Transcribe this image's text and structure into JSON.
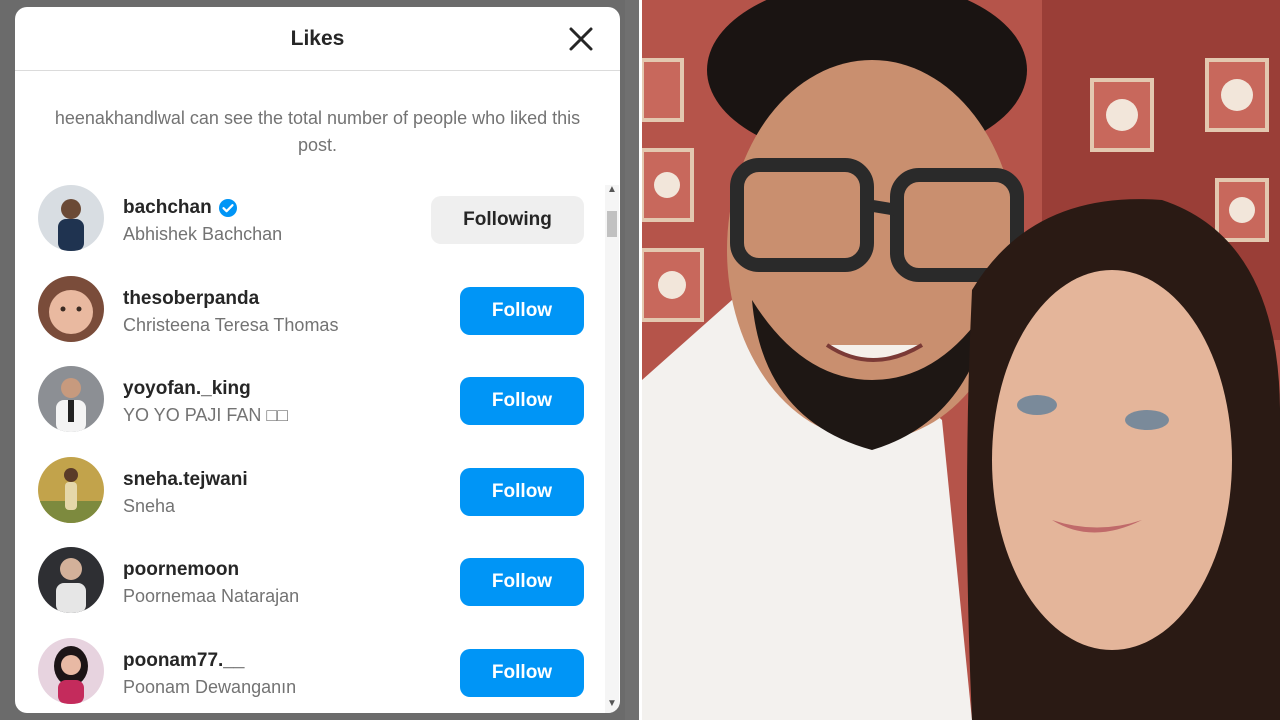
{
  "modal": {
    "title": "Likes",
    "notice": "heenakhandlwal can see the total number of people who liked this post."
  },
  "likers": [
    {
      "username": "bachchan",
      "full_name": "Abhishek Bachchan",
      "button": "Following",
      "verified": true
    },
    {
      "username": "thesoberpanda",
      "full_name": "Christeena Teresa Thomas",
      "button": "Follow",
      "verified": false
    },
    {
      "username": "yoyofan._king",
      "full_name": "YO YO PAJI FAN □□",
      "button": "Follow",
      "verified": false
    },
    {
      "username": "sneha.tejwani",
      "full_name": "Sneha",
      "button": "Follow",
      "verified": false
    },
    {
      "username": "poornemoon",
      "full_name": "Poornemaa Natarajan",
      "button": "Follow",
      "verified": false
    },
    {
      "username": "poonam77.__",
      "full_name": "Poonam Dewanganın",
      "button": "Follow",
      "verified": false
    }
  ],
  "colors": {
    "follow_blue": "#0095f6",
    "verified_blue": "#0095f6"
  },
  "icons": [
    "close-icon",
    "verified-badge-icon",
    "scroll-up-icon",
    "scroll-down-icon"
  ]
}
